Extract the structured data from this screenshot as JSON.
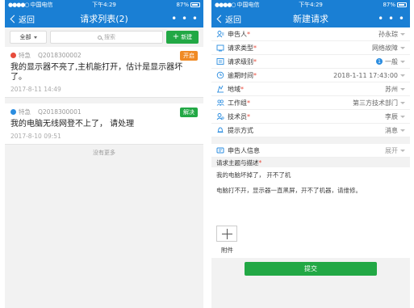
{
  "left": {
    "status": {
      "carrier": "中国电信",
      "time": "下午4:29",
      "battery": "87%"
    },
    "nav": {
      "back": "返回",
      "title": "请求列表(2)",
      "more": "• • •"
    },
    "filter": {
      "select": "全部",
      "search_placeholder": "搜索",
      "new_button": "新建"
    },
    "requests": [
      {
        "priority": "特急",
        "id": "Q2018300002",
        "status": "开启",
        "title": "我的显示器不亮了,主机能打开，估计是显示器坏了。",
        "time": "2017-8-11 14:49"
      },
      {
        "priority": "特急",
        "id": "Q2018300001",
        "status": "解决",
        "title": "我的电脑无线网登不上了， 请处理",
        "time": "2017-8-10 09:51"
      }
    ],
    "no_more": "没有更多"
  },
  "right": {
    "status": {
      "carrier": "中国电信",
      "time": "下午4:29",
      "battery": "87%"
    },
    "nav": {
      "back": "返回",
      "title": "新建请求",
      "more": "• • •"
    },
    "fields": [
      {
        "label": "申告人",
        "required": "*",
        "value": "孙永琮",
        "icon": "user-icon"
      },
      {
        "label": "请求类型",
        "required": "*",
        "value": "网络故障",
        "icon": "type-icon"
      },
      {
        "label": "请求级别",
        "required": "*",
        "value": "一般",
        "badge": "1",
        "icon": "level-icon"
      },
      {
        "label": "逾期时间",
        "required": "*",
        "value": "2018-1-11 17:43:00",
        "icon": "clock-icon"
      },
      {
        "label": "地域",
        "required": "*",
        "value": "苏州",
        "icon": "location-icon"
      },
      {
        "label": "工作组",
        "required": "*",
        "value": "第三方技术部门",
        "icon": "group-icon"
      },
      {
        "label": "技术员",
        "required": "*",
        "value": "李辰",
        "icon": "tech-icon"
      },
      {
        "label": "提示方式",
        "required": "",
        "value": "消息",
        "icon": "bell-icon"
      }
    ],
    "info_row": {
      "label": "申告人信息",
      "value": "展开"
    },
    "desc_head": {
      "label": "请求主题与描述",
      "required": "*"
    },
    "desc_lines": [
      "我的电脑坏掉了， 开不了机",
      "电脑打不开，显示器一直黑屏，开不了机器，请维修。"
    ],
    "attach_label": "附件",
    "submit": "提交"
  },
  "colors": {
    "primary": "#1a7fd4",
    "green": "#22a845",
    "orange": "#f08a24",
    "red": "#e74c3c"
  }
}
